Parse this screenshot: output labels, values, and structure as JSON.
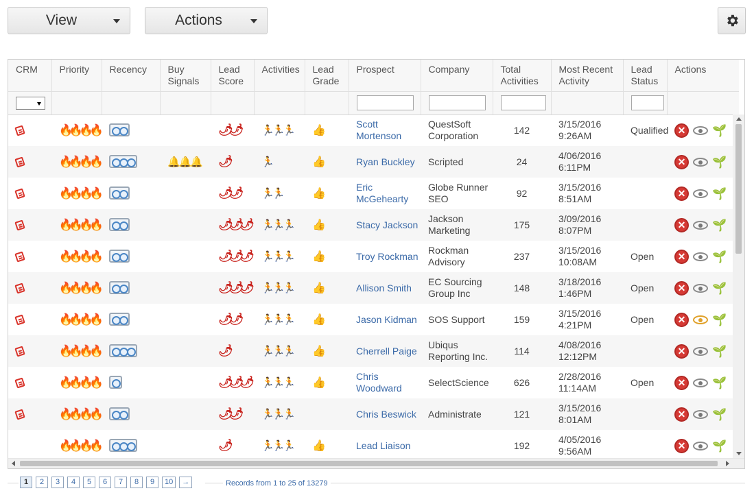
{
  "toolbar": {
    "view_label": "View",
    "actions_label": "Actions",
    "settings_icon": "gear-icon"
  },
  "columns": [
    "CRM",
    "Priority",
    "Recency",
    "Buy Signals",
    "Lead Score",
    "Activities",
    "Lead Grade",
    "Prospect",
    "Company",
    "Total Activities",
    "Most Recent Activity",
    "Lead Status",
    "Actions"
  ],
  "rows": [
    {
      "crm": true,
      "priority": 4,
      "recency": 2,
      "buy_signals": 0,
      "lead_score": 2,
      "activities": 3,
      "lead_grade": true,
      "prospect": "Scott Mortenson",
      "company": "QuestSoft Corporation",
      "total": "142",
      "recent": "3/15/2016 9:26AM",
      "status": "Qualified",
      "view_highlight": false,
      "plant_green": false
    },
    {
      "crm": true,
      "priority": 4,
      "recency": 3,
      "buy_signals": 3,
      "lead_score": 1,
      "activities": 1,
      "lead_grade": true,
      "prospect": "Ryan Buckley",
      "company": "Scripted",
      "total": "24",
      "recent": "4/06/2016 6:11PM",
      "status": "",
      "view_highlight": false,
      "plant_green": false
    },
    {
      "crm": true,
      "priority": 4,
      "recency": 2,
      "buy_signals": 0,
      "lead_score": 2,
      "activities": 2,
      "lead_grade": true,
      "prospect": "Eric McGehearty",
      "company": "Globe Runner SEO",
      "total": "92",
      "recent": "3/15/2016 8:51AM",
      "status": "",
      "view_highlight": false,
      "plant_green": true
    },
    {
      "crm": true,
      "priority": 4,
      "recency": 2,
      "buy_signals": 0,
      "lead_score": 3,
      "activities": 3,
      "lead_grade": true,
      "prospect": "Stacy Jackson",
      "company": "Jackson Marketing",
      "total": "175",
      "recent": "3/09/2016 8:07PM",
      "status": "",
      "view_highlight": false,
      "plant_green": true
    },
    {
      "crm": true,
      "priority": 4,
      "recency": 2,
      "buy_signals": 0,
      "lead_score": 3,
      "activities": 3,
      "lead_grade": true,
      "prospect": "Troy Rockman",
      "company": "Rockman Advisory",
      "total": "237",
      "recent": "3/15/2016 10:08AM",
      "status": "Open",
      "view_highlight": false,
      "plant_green": false
    },
    {
      "crm": true,
      "priority": 4,
      "recency": 2,
      "buy_signals": 0,
      "lead_score": 3,
      "activities": 3,
      "lead_grade": true,
      "prospect": "Allison Smith",
      "company": "EC Sourcing Group Inc",
      "total": "148",
      "recent": "3/18/2016 1:46PM",
      "status": "Open",
      "view_highlight": false,
      "plant_green": true
    },
    {
      "crm": true,
      "priority": 4,
      "recency": 2,
      "buy_signals": 0,
      "lead_score": 2,
      "activities": 3,
      "lead_grade": true,
      "prospect": "Jason Kidman",
      "company": "SOS Support",
      "total": "159",
      "recent": "3/15/2016 4:21PM",
      "status": "Open",
      "view_highlight": true,
      "plant_green": true
    },
    {
      "crm": true,
      "priority": 4,
      "recency": 3,
      "buy_signals": 0,
      "lead_score": 1,
      "activities": 3,
      "lead_grade": true,
      "prospect": "Cherrell Paige",
      "company": "Ubiqus Reporting Inc.",
      "total": "114",
      "recent": "4/08/2016 12:12PM",
      "status": "",
      "view_highlight": false,
      "plant_green": false
    },
    {
      "crm": true,
      "priority": 4,
      "recency": 1,
      "buy_signals": 0,
      "lead_score": 3,
      "activities": 3,
      "lead_grade": true,
      "prospect": "Chris Woodward",
      "company": "SelectScience",
      "total": "626",
      "recent": "2/28/2016 11:14AM",
      "status": "Open",
      "view_highlight": false,
      "plant_green": true
    },
    {
      "crm": true,
      "priority": 4,
      "recency": 2,
      "buy_signals": 0,
      "lead_score": 2,
      "activities": 3,
      "lead_grade": false,
      "prospect": "Chris Beswick",
      "company": "Administrate",
      "total": "121",
      "recent": "3/15/2016 8:01AM",
      "status": "",
      "view_highlight": false,
      "plant_green": true
    },
    {
      "crm": false,
      "priority": 4,
      "recency": 3,
      "buy_signals": 0,
      "lead_score": 1,
      "activities": 3,
      "lead_grade": true,
      "prospect": "Lead Liaison",
      "company": "",
      "total": "192",
      "recent": "4/05/2016 9:56AM",
      "status": "",
      "view_highlight": false,
      "plant_green": false
    }
  ],
  "pager": {
    "pages": [
      "1",
      "2",
      "3",
      "4",
      "5",
      "6",
      "7",
      "8",
      "9",
      "10",
      "→"
    ],
    "current": "1",
    "records": "Records from 1 to 25 of 13279"
  }
}
